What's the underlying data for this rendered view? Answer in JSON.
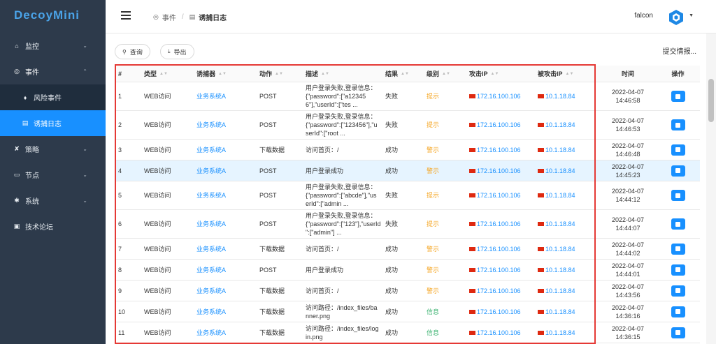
{
  "app": {
    "logo": "DecoyMini"
  },
  "sidebar": {
    "items": [
      {
        "label": "监控",
        "icon": "home-icon"
      },
      {
        "label": "事件",
        "icon": "target-icon"
      },
      {
        "label": "风险事件",
        "icon": "bell-icon"
      },
      {
        "label": "诱捕日志",
        "icon": "doc-icon"
      },
      {
        "label": "策略",
        "icon": "tools-icon"
      },
      {
        "label": "节点",
        "icon": "monitor-icon"
      },
      {
        "label": "系统",
        "icon": "gear-icon"
      },
      {
        "label": "技术论坛",
        "icon": "chat-icon"
      }
    ]
  },
  "header": {
    "breadcrumb": [
      "事件",
      "诱捕日志"
    ],
    "user": "falcon"
  },
  "toolbar": {
    "query": "查询",
    "export": "导出",
    "submit_intel": "提交情报..."
  },
  "table": {
    "columns": [
      "#",
      "类型",
      "诱捕器",
      "动作",
      "描述",
      "结果",
      "级别",
      "攻击IP",
      "被攻击IP",
      "时间",
      "操作"
    ],
    "rows": [
      {
        "n": "1",
        "type": "WEB访问",
        "trap": "业务系统A",
        "action": "POST",
        "desc_l1": "用户登录失败,登录信息：",
        "desc_l2": "{\"password\":[\"a12345",
        "desc_l3": "6\"],\"userId\":[\"tes ...",
        "result": "失败",
        "level": "提示",
        "lc": "orange",
        "src": "172.16.100.106",
        "dst": "10.1.18.84",
        "date": "2022-04-07",
        "time": "14:46:58"
      },
      {
        "n": "2",
        "type": "WEB访问",
        "trap": "业务系统A",
        "action": "POST",
        "desc_l1": "用户登录失败,登录信息：",
        "desc_l2": "{\"password\":[\"123456\"],\"u",
        "desc_l3": "serId\":[\"root ...",
        "result": "失败",
        "level": "提示",
        "lc": "orange",
        "src": "172.16.100.106",
        "dst": "10.1.18.84",
        "date": "2022-04-07",
        "time": "14:46:53"
      },
      {
        "n": "3",
        "type": "WEB访问",
        "trap": "业务系统A",
        "action": "下载数据",
        "desc_l1": "访问首页：/",
        "desc_l2": "",
        "desc_l3": "",
        "result": "成功",
        "level": "警示",
        "lc": "orange",
        "src": "172.16.100.106",
        "dst": "10.1.18.84",
        "date": "2022-04-07",
        "time": "14:46:48"
      },
      {
        "n": "4",
        "type": "WEB访问",
        "trap": "业务系统A",
        "action": "POST",
        "desc_l1": "用户登录成功",
        "desc_l2": "",
        "desc_l3": "",
        "result": "成功",
        "level": "警示",
        "lc": "orange",
        "src": "172.16.100.106",
        "dst": "10.1.18.84",
        "date": "2022-04-07",
        "time": "14:45:23"
      },
      {
        "n": "5",
        "type": "WEB访问",
        "trap": "业务系统A",
        "action": "POST",
        "desc_l1": "用户登录失败,登录信息：",
        "desc_l2": "{\"password\":[\"abcde\"],\"us",
        "desc_l3": "erId\":[\"admin ...",
        "result": "失败",
        "level": "提示",
        "lc": "orange",
        "src": "172.16.100.106",
        "dst": "10.1.18.84",
        "date": "2022-04-07",
        "time": "14:44:12"
      },
      {
        "n": "6",
        "type": "WEB访问",
        "trap": "业务系统A",
        "action": "POST",
        "desc_l1": "用户登录失败,登录信息：",
        "desc_l2": "{\"password\":[\"123\"],\"userId",
        "desc_l3": "\":[\"admin\"] ...",
        "result": "失败",
        "level": "提示",
        "lc": "orange",
        "src": "172.16.100.106",
        "dst": "10.1.18.84",
        "date": "2022-04-07",
        "time": "14:44:07"
      },
      {
        "n": "7",
        "type": "WEB访问",
        "trap": "业务系统A",
        "action": "下载数据",
        "desc_l1": "访问首页：/",
        "desc_l2": "",
        "desc_l3": "",
        "result": "成功",
        "level": "警示",
        "lc": "orange",
        "src": "172.16.100.106",
        "dst": "10.1.18.84",
        "date": "2022-04-07",
        "time": "14:44:02"
      },
      {
        "n": "8",
        "type": "WEB访问",
        "trap": "业务系统A",
        "action": "POST",
        "desc_l1": "用户登录成功",
        "desc_l2": "",
        "desc_l3": "",
        "result": "成功",
        "level": "警示",
        "lc": "orange",
        "src": "172.16.100.106",
        "dst": "10.1.18.84",
        "date": "2022-04-07",
        "time": "14:44:01"
      },
      {
        "n": "9",
        "type": "WEB访问",
        "trap": "业务系统A",
        "action": "下载数据",
        "desc_l1": "访问首页：/",
        "desc_l2": "",
        "desc_l3": "",
        "result": "成功",
        "level": "警示",
        "lc": "orange",
        "src": "172.16.100.106",
        "dst": "10.1.18.84",
        "date": "2022-04-07",
        "time": "14:43:56"
      },
      {
        "n": "10",
        "type": "WEB访问",
        "trap": "业务系统A",
        "action": "下载数据",
        "desc_l1": "访问路径：/index_files/ba",
        "desc_l2": "nner.png",
        "desc_l3": "",
        "result": "成功",
        "level": "信息",
        "lc": "green",
        "src": "172.16.100.106",
        "dst": "10.1.18.84",
        "date": "2022-04-07",
        "time": "14:36:16"
      },
      {
        "n": "11",
        "type": "WEB访问",
        "trap": "业务系统A",
        "action": "下载数据",
        "desc_l1": "访问路径：/index_files/log",
        "desc_l2": "in.png",
        "desc_l3": "",
        "result": "成功",
        "level": "信息",
        "lc": "green",
        "src": "172.16.100.106",
        "dst": "10.1.18.84",
        "date": "2022-04-07",
        "time": "14:36:15"
      }
    ]
  },
  "colors": {
    "accent": "#1890ff",
    "sidebar_bg": "#2d3a4b",
    "highlight_box": "#e53935"
  }
}
